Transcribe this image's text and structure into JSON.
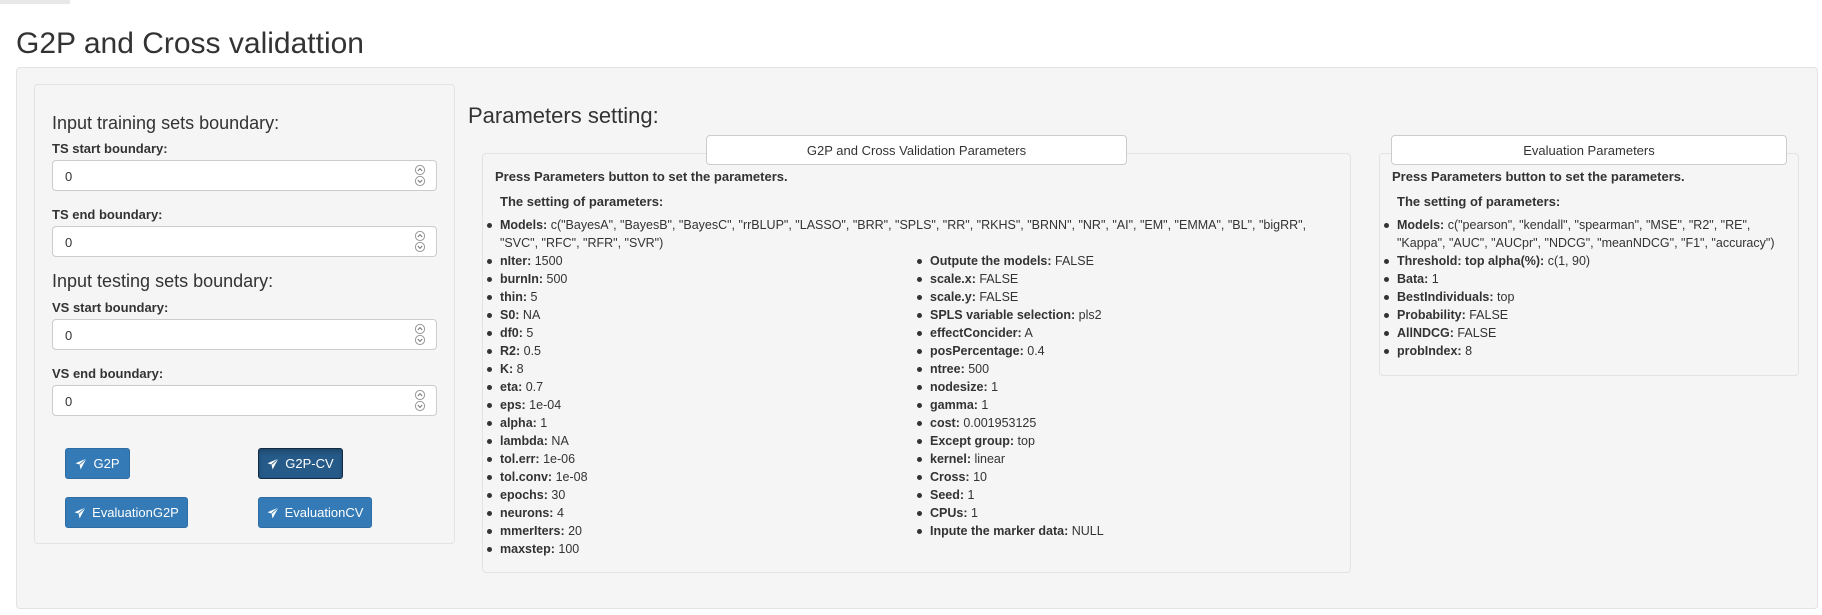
{
  "page": {
    "title": "G2P and Cross validattion"
  },
  "sidebar": {
    "training_heading": "Input training sets boundary:",
    "ts_start": {
      "label": "TS start boundary:",
      "value": "0"
    },
    "ts_end": {
      "label": "TS end boundary:",
      "value": "0"
    },
    "testing_heading": "Input testing sets boundary:",
    "vs_start": {
      "label": "VS start boundary:",
      "value": "0"
    },
    "vs_end": {
      "label": "VS end boundary:",
      "value": "0"
    },
    "buttons": {
      "g2p": "G2P",
      "g2pcv": "G2P-CV",
      "eval_g2p": "EvaluationG2P",
      "eval_cv": "EvaluationCV"
    }
  },
  "main": {
    "title": "Parameters setting:",
    "g2p_panel": {
      "button": "G2P and Cross Validation Parameters",
      "press": "Press Parameters button to set the parameters.",
      "setting_heading": "The setting of parameters:",
      "models": {
        "key": "Models:",
        "val": " c(\"BayesA\", \"BayesB\", \"BayesC\", \"rrBLUP\", \"LASSO\", \"BRR\", \"SPLS\", \"RR\", \"RKHS\", \"BRNN\", \"NR\", \"AI\", \"EM\", \"EMMA\", \"BL\", \"bigRR\", \"SVC\", \"RFC\", \"RFR\", \"SVR\")"
      },
      "left_col": [
        {
          "key": "nIter:",
          "val": " 1500"
        },
        {
          "key": "burnIn:",
          "val": " 500"
        },
        {
          "key": "thin:",
          "val": " 5"
        },
        {
          "key": "S0:",
          "val": " NA"
        },
        {
          "key": "df0:",
          "val": " 5"
        },
        {
          "key": "R2:",
          "val": " 0.5"
        },
        {
          "key": "K:",
          "val": " 8"
        },
        {
          "key": "eta:",
          "val": " 0.7"
        },
        {
          "key": "eps:",
          "val": " 1e-04"
        },
        {
          "key": "alpha:",
          "val": " 1"
        },
        {
          "key": "lambda:",
          "val": " NA"
        },
        {
          "key": "tol.err:",
          "val": " 1e-06"
        },
        {
          "key": "tol.conv:",
          "val": " 1e-08"
        },
        {
          "key": "epochs:",
          "val": " 30"
        },
        {
          "key": "neurons:",
          "val": " 4"
        },
        {
          "key": "mmerIters:",
          "val": " 20"
        },
        {
          "key": "maxstep:",
          "val": " 100"
        }
      ],
      "right_col": [
        {
          "key": "Outpute the models:",
          "val": " FALSE"
        },
        {
          "key": "scale.x:",
          "val": " FALSE"
        },
        {
          "key": "scale.y:",
          "val": " FALSE"
        },
        {
          "key": "SPLS variable selection:",
          "val": " pls2"
        },
        {
          "key": "effectConcider:",
          "val": " A"
        },
        {
          "key": "posPercentage:",
          "val": " 0.4"
        },
        {
          "key": "ntree:",
          "val": " 500"
        },
        {
          "key": "nodesize:",
          "val": " 1"
        },
        {
          "key": "gamma:",
          "val": " 1"
        },
        {
          "key": "cost:",
          "val": " 0.001953125"
        },
        {
          "key": "Except group:",
          "val": " top"
        },
        {
          "key": "kernel:",
          "val": " linear"
        },
        {
          "key": "Cross:",
          "val": " 10"
        },
        {
          "key": "Seed:",
          "val": " 1"
        },
        {
          "key": "CPUs:",
          "val": " 1"
        },
        {
          "key": "Inpute the marker data:",
          "val": " NULL"
        }
      ]
    },
    "eval_panel": {
      "button": "Evaluation Parameters",
      "press": "Press Parameters button to set the parameters.",
      "setting_heading": "The setting of parameters:",
      "items": [
        {
          "key": "Models:",
          "val": " c(\"pearson\", \"kendall\", \"spearman\", \"MSE\", \"R2\", \"RE\", \"Kappa\", \"AUC\", \"AUCpr\", \"NDCG\", \"meanNDCG\", \"F1\", \"accuracy\")"
        },
        {
          "key": "Threshold: top alpha(%):",
          "val": " c(1, 90)"
        },
        {
          "key": "Bata:",
          "val": " 1"
        },
        {
          "key": "BestIndividuals:",
          "val": " top"
        },
        {
          "key": "Probability:",
          "val": " FALSE"
        },
        {
          "key": "AllNDCG:",
          "val": " FALSE"
        },
        {
          "key": "probIndex:",
          "val": " 8"
        }
      ]
    }
  }
}
